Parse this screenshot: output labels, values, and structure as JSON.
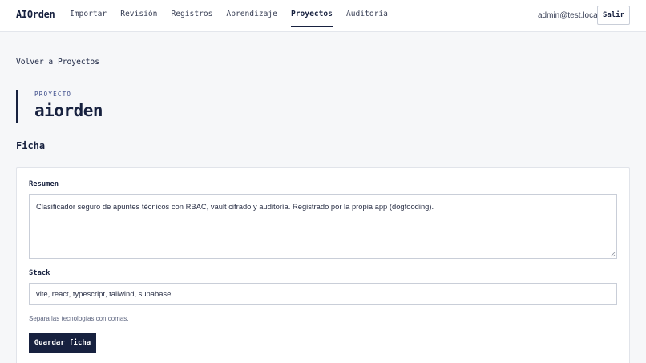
{
  "app": {
    "brand": "AIOrden"
  },
  "nav": {
    "items": [
      {
        "label": "Importar"
      },
      {
        "label": "Revisión"
      },
      {
        "label": "Registros"
      },
      {
        "label": "Aprendizaje"
      },
      {
        "label": "Proyectos",
        "active": true
      },
      {
        "label": "Auditoría"
      }
    ]
  },
  "user": {
    "email": "admin@test.local",
    "logout_label": "Salir"
  },
  "back_link": "Volver a Proyectos",
  "project": {
    "kicker": "PROYECTO",
    "name": "aiorden"
  },
  "section": {
    "title": "Ficha"
  },
  "form": {
    "summary_label": "Resumen",
    "summary_value": "Clasificador seguro de apuntes técnicos con RBAC, vault cifrado y auditoría. Registrado por la propia app (dogfooding).",
    "stack_label": "Stack",
    "stack_value": "vite, react, typescript, tailwind, supabase",
    "stack_hint": "Separa las tecnologías con comas.",
    "save_label": "Guardar ficha"
  },
  "colors": {
    "primary": "#17213f",
    "accent_text": "#3b4b8a",
    "background": "#f6f7f9"
  }
}
